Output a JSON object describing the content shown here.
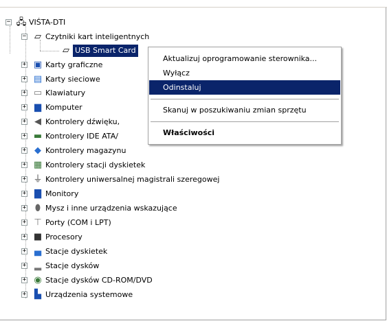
{
  "tree": {
    "root": {
      "label": "VIŚTA-DTI",
      "icon": "computer-network-icon"
    },
    "expanded_category": {
      "label": "Czytniki kart inteligentnych",
      "icon": "smart-card-reader-icon"
    },
    "selected_device": {
      "label": "USB Smart Card",
      "icon": "smart-card-reader-icon"
    },
    "categories": [
      {
        "label": "Karty graficzne",
        "icon": "display-adapter-icon"
      },
      {
        "label": "Karty sieciowe",
        "icon": "network-adapter-icon"
      },
      {
        "label": "Klawiatury",
        "icon": "keyboard-icon"
      },
      {
        "label": "Komputer",
        "icon": "computer-icon"
      },
      {
        "label": "Kontrolery dźwięku,",
        "icon": "speaker-icon"
      },
      {
        "label": "Kontrolery IDE ATA/",
        "icon": "ide-controller-icon"
      },
      {
        "label": "Kontrolery magazynu",
        "icon": "storage-controller-icon"
      },
      {
        "label": "Kontrolery stacji dyskietek",
        "icon": "floppy-controller-icon"
      },
      {
        "label": "Kontrolery uniwersalnej magistrali szeregowej",
        "icon": "usb-icon"
      },
      {
        "label": "Monitory",
        "icon": "monitor-icon"
      },
      {
        "label": "Mysz i inne urządzenia wskazujące",
        "icon": "mouse-icon"
      },
      {
        "label": "Porty (COM i LPT)",
        "icon": "port-icon"
      },
      {
        "label": "Procesory",
        "icon": "processor-icon"
      },
      {
        "label": "Stacje dyskietek",
        "icon": "floppy-drive-icon"
      },
      {
        "label": "Stacje dysków",
        "icon": "disk-drive-icon"
      },
      {
        "label": "Stacje dysków CD-ROM/DVD",
        "icon": "cdrom-icon"
      },
      {
        "label": "Urządzenia systemowe",
        "icon": "system-device-icon"
      }
    ]
  },
  "context_menu": {
    "update_driver": "Aktualizuj oprogramowanie sterownika...",
    "disable": "Wyłącz",
    "uninstall": "Odinstaluj",
    "scan": "Skanuj w poszukiwaniu zmian sprzętu",
    "properties": "Właściwości"
  },
  "colors": {
    "selection": "#0a246a",
    "selection_text": "#ffffff"
  }
}
